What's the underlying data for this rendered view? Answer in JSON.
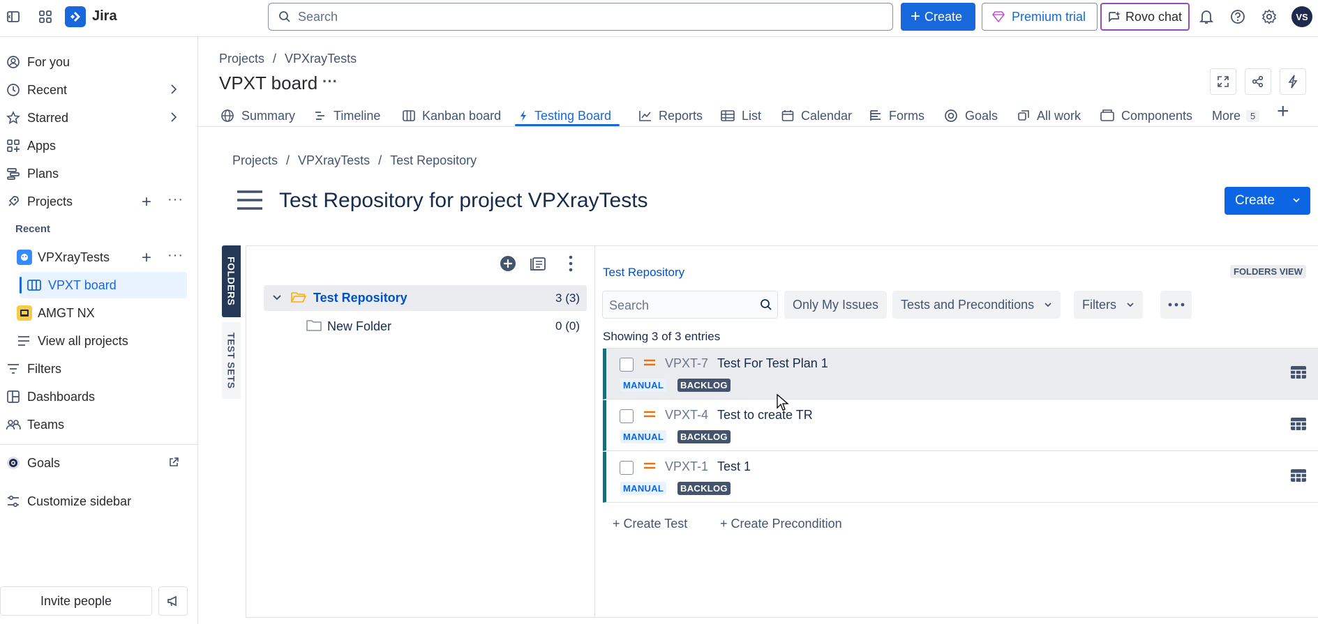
{
  "topbar": {
    "app_name": "Jira",
    "search_placeholder": "Search",
    "create_label": "Create",
    "premium_label": "Premium trial",
    "rovo_label": "Rovo chat",
    "avatar_initials": "VS"
  },
  "sidebar": {
    "items": [
      {
        "label": "For you"
      },
      {
        "label": "Recent"
      },
      {
        "label": "Starred"
      },
      {
        "label": "Apps"
      },
      {
        "label": "Plans"
      },
      {
        "label": "Projects"
      }
    ],
    "recent_heading": "Recent",
    "projects": [
      {
        "label": "VPXrayTests"
      },
      {
        "label": "VPXT board"
      },
      {
        "label": "AMGT NX"
      },
      {
        "label": "View all projects"
      }
    ],
    "bottom_items": [
      {
        "label": "Filters"
      },
      {
        "label": "Dashboards"
      },
      {
        "label": "Teams"
      },
      {
        "label": "Goals"
      },
      {
        "label": "Customize sidebar"
      }
    ],
    "invite_label": "Invite people"
  },
  "header": {
    "breadcrumb": [
      "Projects",
      "/",
      "VPXrayTests"
    ],
    "title": "VPXT board",
    "more": "···"
  },
  "tabs": [
    {
      "label": "Summary"
    },
    {
      "label": "Timeline"
    },
    {
      "label": "Kanban board"
    },
    {
      "label": "Testing Board"
    },
    {
      "label": "Reports"
    },
    {
      "label": "List"
    },
    {
      "label": "Calendar"
    },
    {
      "label": "Forms"
    },
    {
      "label": "Goals"
    },
    {
      "label": "All work"
    },
    {
      "label": "Components"
    },
    {
      "label": "More"
    }
  ],
  "tabs_more_count": "5",
  "repo": {
    "breadcrumb": [
      "Projects",
      "/",
      "VPXrayTests",
      "/",
      "Test Repository"
    ],
    "title": "Test Repository for project VPXrayTests",
    "create_label": "Create",
    "vtabs": [
      "FOLDERS",
      "TEST SETS"
    ],
    "folders": [
      {
        "name": "Test Repository",
        "count": "3 (3)"
      },
      {
        "name": "New Folder",
        "count": "0 (0)"
      }
    ],
    "panel_title": "Test Repository",
    "view_badge": "FOLDERS VIEW",
    "search_placeholder": "Search",
    "only_mine": "Only My Issues",
    "type_filter": "Tests and Preconditions",
    "filters": "Filters",
    "showing": "Showing 3 of 3 entries",
    "rows": [
      {
        "key": "VPXT-7",
        "summary": "Test For Test Plan 1",
        "type": "MANUAL",
        "status": "BACKLOG"
      },
      {
        "key": "VPXT-4",
        "summary": "Test to create TR",
        "type": "MANUAL",
        "status": "BACKLOG"
      },
      {
        "key": "VPXT-1",
        "summary": "Test 1",
        "type": "MANUAL",
        "status": "BACKLOG"
      }
    ],
    "create_test": "+ Create Test",
    "create_precondition": "+ Create Precondition"
  }
}
